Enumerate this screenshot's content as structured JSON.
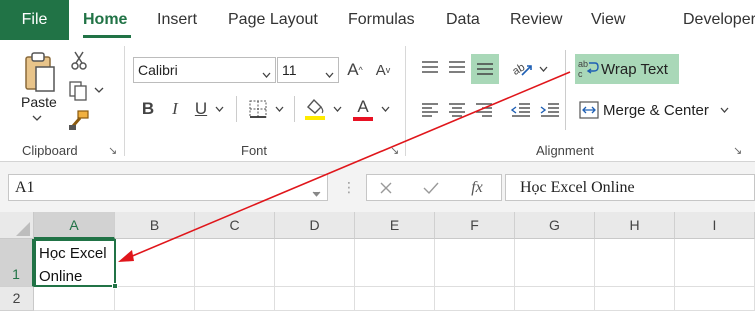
{
  "tabs": {
    "file": "File",
    "items": [
      {
        "label": "Home",
        "active": true
      },
      {
        "label": "Insert"
      },
      {
        "label": "Page Layout"
      },
      {
        "label": "Formulas"
      },
      {
        "label": "Data"
      },
      {
        "label": "Review"
      },
      {
        "label": "View"
      },
      {
        "label": "Developer"
      }
    ]
  },
  "ribbon": {
    "clipboard": {
      "paste_label": "Paste",
      "group_label": "Clipboard",
      "icons": [
        "paste-icon",
        "cut-icon",
        "copy-icon",
        "format-painter-icon",
        "dialog-launcher-icon"
      ]
    },
    "font": {
      "group_label": "Font",
      "font_name": "Calibri",
      "font_size": "11",
      "grow_label": "A",
      "shrink_label": "A",
      "bold": "B",
      "italic": "I",
      "underline": "U",
      "font_color_letter": "A",
      "highlight_color": "#ffeb00",
      "font_color": "#e81123"
    },
    "alignment": {
      "group_label": "Alignment",
      "wrap_text_label": "Wrap Text",
      "merge_center_label": "Merge & Center"
    }
  },
  "formula_bar": {
    "name_box": "A1",
    "fx_label": "fx",
    "formula": "Học Excel Online"
  },
  "grid": {
    "columns": [
      "A",
      "B",
      "C",
      "D",
      "E",
      "F",
      "G",
      "H",
      "I"
    ],
    "rows": [
      "1",
      "2"
    ],
    "cells": {
      "A1_line1": "Học Excel",
      "A1_line2": "Online"
    }
  },
  "colors": {
    "accent": "#217346",
    "wrap_highlight": "#a9d8b8",
    "annotation_arrow": "#e0161b"
  }
}
